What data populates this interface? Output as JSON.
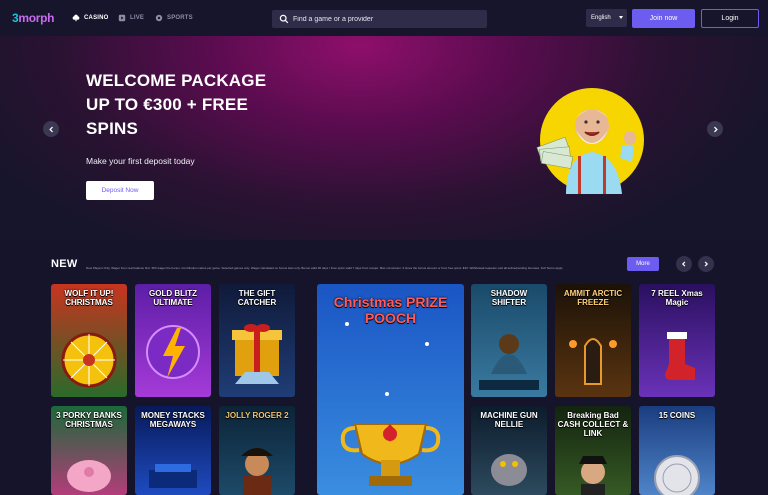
{
  "header": {
    "logo_part1": "3",
    "logo_part2": "morph",
    "nav": [
      {
        "label": "CASINO",
        "icon": "cards-icon",
        "active": true
      },
      {
        "label": "LIVE",
        "icon": "live-tv-icon",
        "active": false
      },
      {
        "label": "SPORTS",
        "icon": "ball-icon",
        "active": false
      }
    ],
    "search_placeholder": "Find a game or a provider",
    "language": "English",
    "join_label": "Join now",
    "login_label": "Login"
  },
  "hero": {
    "title_lines": [
      "WELCOME PACKAGE",
      "UP TO €300 + FREE",
      "SPINS"
    ],
    "subtitle": "Make your first deposit today",
    "cta_label": "Deposit Now",
    "terms": "New Players Only. Wager from real balance first. 35X wager the bonus. Contribution varies per game. Selected games only. Wager calculated on bonus bets only. Bonus valid 30 days / Free spins valid 7 days from receipt. Max conversion: 3 times the bonus amount or from free spins: €20. Withdrawal requests void all active/pending bonuses. Full Terms apply."
  },
  "new_section": {
    "title": "NEW",
    "more_label": "More",
    "games": [
      {
        "name": "WOLF IT UP! CHRISTMAS",
        "colors": [
          "#c8341f",
          "#2a6a2a"
        ]
      },
      {
        "name": "GOLD BLITZ ULTIMATE",
        "colors": [
          "#5d1ea6",
          "#a53ad8"
        ]
      },
      {
        "name": "THE GIFT CATCHER",
        "colors": [
          "#101a3a",
          "#1f3d76"
        ]
      },
      {
        "name": "Christmas PRIZE POOCH",
        "colors": [
          "#1a55c4",
          "#3a8ee0"
        ]
      },
      {
        "name": "SHADOW SHIFTER",
        "colors": [
          "#1a4a6a",
          "#3a7aa0"
        ]
      },
      {
        "name": "AMMIT ARCTIC FREEZE",
        "colors": [
          "#1c1208",
          "#5a3410"
        ]
      },
      {
        "name": "7 REEL Xmas Magic",
        "colors": [
          "#2a1060",
          "#6a32b8"
        ]
      },
      {
        "name": "3 PORKY BANKS CHRISTMAS",
        "colors": [
          "#1b6a3a",
          "#b33d7a"
        ]
      },
      {
        "name": "MONEY STACKS MEGAWAYS",
        "colors": [
          "#071a5a",
          "#1f4bc0"
        ]
      },
      {
        "name": "JOLLY ROGER 2",
        "colors": [
          "#0c2438",
          "#1d4a68"
        ]
      },
      {
        "name": "MACHINE GUN NELLIE",
        "colors": [
          "#0c1c2c",
          "#2d4a5e"
        ]
      },
      {
        "name": "Breaking Bad CASH COLLECT & LINK",
        "colors": [
          "#13240f",
          "#365a24"
        ]
      },
      {
        "name": "15 COINS",
        "colors": [
          "#1a3d80",
          "#4f84c8"
        ]
      }
    ]
  }
}
